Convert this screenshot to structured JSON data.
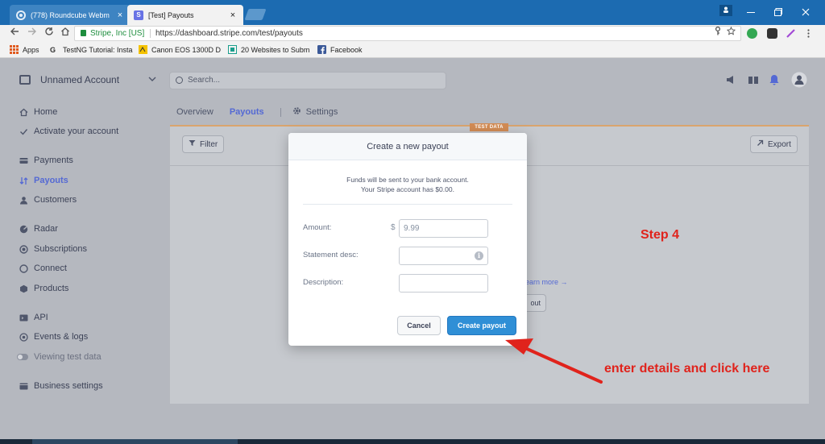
{
  "browser": {
    "tabs": [
      {
        "title": "(778) Roundcube Webm"
      },
      {
        "title": "[Test] Payouts"
      }
    ],
    "tab_close": "×",
    "secure_label": "Stripe, Inc [US]",
    "url": "https://dashboard.stripe.com/test/payouts",
    "bookmarks": [
      {
        "label": "Apps"
      },
      {
        "label": "TestNG Tutorial: Insta"
      },
      {
        "label": "Canon EOS 1300D D"
      },
      {
        "label": "20 Websites to Subm"
      },
      {
        "label": "Facebook"
      }
    ]
  },
  "header": {
    "account_name": "Unnamed Account",
    "search_placeholder": "Search..."
  },
  "sidebar": {
    "items": [
      {
        "label": "Home",
        "icon": "home-icon"
      },
      {
        "label": "Activate your account",
        "icon": "check-icon"
      },
      {
        "label": "Payments",
        "icon": "payments-icon"
      },
      {
        "label": "Payouts",
        "icon": "payouts-icon"
      },
      {
        "label": "Customers",
        "icon": "customers-icon"
      },
      {
        "label": "Radar",
        "icon": "radar-icon"
      },
      {
        "label": "Subscriptions",
        "icon": "subscriptions-icon"
      },
      {
        "label": "Connect",
        "icon": "connect-icon"
      },
      {
        "label": "Products",
        "icon": "products-icon"
      },
      {
        "label": "API",
        "icon": "api-icon"
      },
      {
        "label": "Events & logs",
        "icon": "events-icon"
      },
      {
        "label": "Viewing test data",
        "icon": "toggle-icon"
      },
      {
        "label": "Business settings",
        "icon": "settings-icon"
      }
    ],
    "arrow": "→"
  },
  "subnav": {
    "overview": "Overview",
    "payouts": "Payouts",
    "settings": "Settings"
  },
  "content": {
    "test_badge": "TEST DATA",
    "filter_label": "Filter",
    "export_label": "Export",
    "learn_more": "earn more →",
    "behind_button": "out"
  },
  "modal": {
    "title": "Create a new payout",
    "info_line1": "Funds will be sent to your bank account.",
    "info_line2": "Your Stripe account has $0.00.",
    "amount_label": "Amount:",
    "currency_symbol": "$",
    "amount_value": "9.99",
    "statement_label": "Statement desc:",
    "statement_info": "i",
    "description_label": "Description:",
    "cancel_label": "Cancel",
    "create_label": "Create payout"
  },
  "annotations": {
    "step": "Step 4",
    "instruction": "enter details and click here",
    "color": "#e0231c"
  }
}
